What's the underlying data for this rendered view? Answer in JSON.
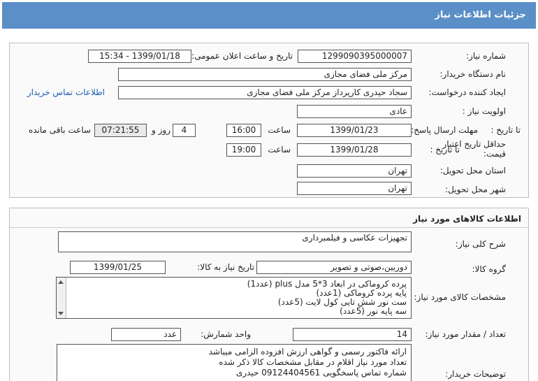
{
  "header": {
    "title": "جزئیات اطلاعات نیاز"
  },
  "info": {
    "need_number_label": "شماره نیاز:",
    "need_number": "1299090395000007",
    "announce_label": "تاریخ و ساعت اعلان عمومی:",
    "announce_value": "1399/01/18 - 15:34",
    "buyer_org_label": "نام دستگاه خریدار:",
    "buyer_org": "مرکز ملی فضای مجازی",
    "creator_label": "ایجاد کننده درخواست:",
    "creator": "سجاد حیدری کارپرداز مرکز ملی فضای مجازی",
    "contact_link": "اطلاعات تماس خریدار",
    "priority_label": "اولویت نیاز :",
    "priority": "عادی",
    "deadline_label": "مهلت ارسال پاسخ:",
    "deadline_to": "تا تاریخ :",
    "deadline_date": "1399/01/23",
    "time_label": "ساعت",
    "deadline_time": "16:00",
    "days_value": "4",
    "days_label": "روز و",
    "remaining_time": "07:21:55",
    "remaining_label": "ساعت باقی مانده",
    "validity_label_1": "حداقل تاریخ اعتبار",
    "validity_label_2": "قیمت:",
    "validity_to": "تا تاریخ :",
    "validity_date": "1399/01/28",
    "validity_time_label": "ساعت",
    "validity_time": "19:00",
    "province_label": "استان محل تحویل:",
    "province": "تهران",
    "city_label": "شهر محل تحویل:",
    "city": "تهران"
  },
  "goods": {
    "section_title": "اطلاعات کالاهای مورد نیاز",
    "summary_label": "شرح کلی نیاز:",
    "summary": "تجهیزات عکاسی و فیلمبرداری",
    "group_label": "گروه کالا:",
    "group": "دوربین،صوتی و تصویر",
    "need_date_label": "تاریخ نیاز به کالا:",
    "need_date": "1399/01/25",
    "specs_label": "مشخصات کالای مورد نیاز:",
    "specs": [
      "پرده کروماکی در ابعاد 3*5 مدل plus (عدد1)",
      "پایه پرده کروماکی (1عدد)",
      "ست نور شش تایی کول لایت (5عدد)",
      "سه پایه نور (5عدد)"
    ],
    "qty_label": "تعداد / مقدار مورد نیاز:",
    "qty": "14",
    "unit_label": "واحد شمارش:",
    "unit": "عدد",
    "notes_label": "توضیحات خریدار:",
    "notes": [
      "ارائه فاکتور رسمی و گواهی ارزش افزوده الزامی میباشد",
      "تعداد مورد نیاز اقلام در مقابل مشخصات کالا ذکر شده",
      "شماره تماس پاسخگویی 09124404561 حیدری"
    ]
  }
}
